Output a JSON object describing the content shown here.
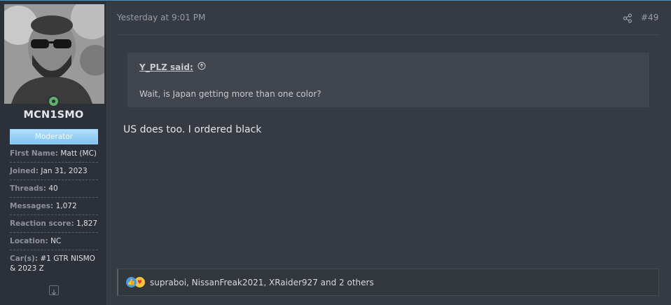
{
  "user": {
    "name": "MCN1SMO",
    "role": "Moderator",
    "fields": [
      {
        "label": "First Name:",
        "value": "Matt (MC)"
      },
      {
        "label": "Joined:",
        "value": "Jan 31, 2023"
      },
      {
        "label": "Threads:",
        "value": "40"
      },
      {
        "label": "Messages:",
        "value": "1,072"
      },
      {
        "label": "Reaction score:",
        "value": "1,827"
      },
      {
        "label": "Location:",
        "value": "NC"
      },
      {
        "label": "Car(s):",
        "value": "#1 GTR NISMO & 2023 Z"
      }
    ],
    "online_color": "#63b06a",
    "badge_color": "#8fcdf4"
  },
  "post": {
    "date": "Yesterday at 9:01 PM",
    "number": "#49",
    "quote": {
      "author": "Y_PLZ said:",
      "text": "Wait, is Japan getting more than one color?"
    },
    "message": "US does too. I ordered black",
    "reactions": {
      "icons": [
        "like-icon",
        "love-icon"
      ],
      "text": "supraboi, NissanFreak2021, XRaider927 and 2 others"
    }
  },
  "colors": {
    "accent": "#4a8fb5",
    "panel": "#363a42",
    "sidebar": "#2c3038"
  }
}
